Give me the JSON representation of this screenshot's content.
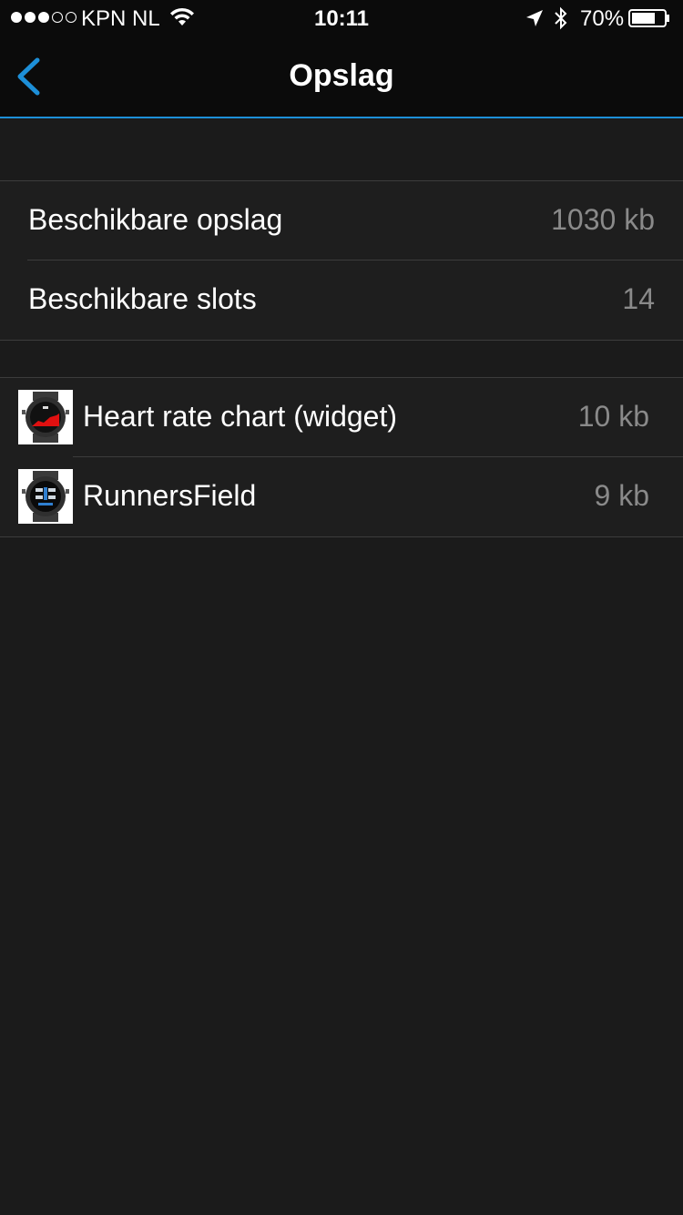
{
  "status_bar": {
    "carrier": "KPN NL",
    "time": "10:11",
    "battery": "70%"
  },
  "nav": {
    "title": "Opslag",
    "back_icon": "chevron-left-icon"
  },
  "storage": {
    "rows": [
      {
        "label": "Beschikbare opslag",
        "value": "1030 kb"
      },
      {
        "label": "Beschikbare slots",
        "value": "14"
      }
    ]
  },
  "apps": {
    "rows": [
      {
        "label": "Heart rate chart (widget)",
        "value": "10 kb",
        "icon": "watch-heart-rate-thumbnail"
      },
      {
        "label": "RunnersField",
        "value": "9 kb",
        "icon": "watch-runnersfield-thumbnail"
      }
    ]
  },
  "colors": {
    "accent": "#1d8fd8",
    "background": "#1b1b1b",
    "value_text": "#8a8a8a"
  }
}
